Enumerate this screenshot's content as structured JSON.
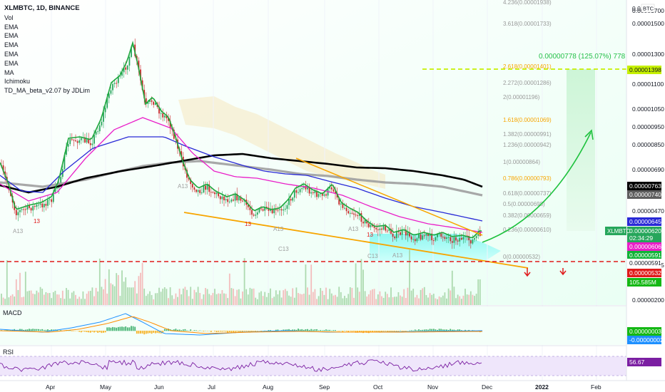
{
  "header": {
    "symbol": "XLMBTC, 1D, BINANCE",
    "indicators": [
      "Vol",
      "EMA",
      "EMA",
      "EMA",
      "EMA",
      "EMA",
      "MA",
      "Ichimoku",
      "TD_MA_beta_v2.07 by JDLim"
    ]
  },
  "panes": {
    "macd_label": "MACD",
    "rsi_label": "RSI"
  },
  "price_axis": {
    "currency": "BTC",
    "top_label": "0.0",
    "ticks": [
      "0.00001700",
      "0.00001500",
      "0.00001300",
      "0.00001100",
      "0.00001050",
      "0.00000950",
      "0.00000850",
      "0.00000690",
      "0.00000470",
      "0.00000435",
      "0.00000200"
    ]
  },
  "x_axis": {
    "labels": [
      "Apr",
      "May",
      "Jun",
      "Jul",
      "Aug",
      "Sep",
      "Oct",
      "Nov",
      "Dec",
      "2022",
      "Feb"
    ]
  },
  "badges": [
    {
      "text": "0.00001398",
      "bg": "#c6f000",
      "fg": "#131722"
    },
    {
      "text": "0.00000763",
      "bg": "#000000",
      "fg": "#ffffff"
    },
    {
      "text": "0.00000740",
      "bg": "#5d5d5d",
      "fg": "#ffffff"
    },
    {
      "text": "0.00000645",
      "bg": "#2929d6",
      "fg": "#ffffff"
    },
    {
      "text": "0.00000620",
      "bg": "#26a65b",
      "fg": "#ffffff"
    },
    {
      "text": "02:34:29",
      "bg": "#26a65b",
      "fg": "#ffffff"
    },
    {
      "text": "0.00000606",
      "bg": "#e91ec8",
      "fg": "#ffffff"
    },
    {
      "text": "0.00000591",
      "bg": "#0fb336",
      "fg": "#ffffff"
    },
    {
      "text": "0.00000591",
      "bg": "#ffffff",
      "fg": "#131722"
    },
    {
      "text": "0.00000532",
      "bg": "#e01a1a",
      "fg": "#ffffff"
    },
    {
      "text": "105.585M",
      "bg": "#14b814",
      "fg": "#ffffff"
    },
    {
      "text": "0.00000003",
      "bg": "#14b814",
      "fg": "#ffffff"
    },
    {
      "text": "-0.00000002",
      "bg": "#1e90ff",
      "fg": "#ffffff"
    },
    {
      "text": "56.67",
      "bg": "#7b1fa2",
      "fg": "#ffffff"
    }
  ],
  "symbol_tag": "XLMBTC",
  "target_label": "0.00000778 (125.07%) 778",
  "fib_levels": [
    {
      "text": "4.236(0.00001938)",
      "color": "#999999"
    },
    {
      "text": "3.618(0.00001733)",
      "color": "#999999"
    },
    {
      "text": "2.618(0.00001401)",
      "color": "#f7a500"
    },
    {
      "text": "2.272(0.00001286)",
      "color": "#999999"
    },
    {
      "text": "2(0.00001196)",
      "color": "#999999"
    },
    {
      "text": "1.618(0.00001069)",
      "color": "#f7a500"
    },
    {
      "text": "1.382(0.00000991)",
      "color": "#999999"
    },
    {
      "text": "1.236(0.00000942)",
      "color": "#999999"
    },
    {
      "text": "1(0.00000864)",
      "color": "#999999"
    },
    {
      "text": "0.786(0.00000793)",
      "color": "#f7a500"
    },
    {
      "text": "0.618(0.00000737)",
      "color": "#999999"
    },
    {
      "text": "0.5(0.00000698)",
      "color": "#999999"
    },
    {
      "text": "0.382(0.00000659)",
      "color": "#999999"
    },
    {
      "text": "0.236(0.00000610)",
      "color": "#999999"
    },
    {
      "text": "0(0.00000532)",
      "color": "#999999"
    }
  ],
  "td_labels": [
    "A13",
    "13",
    "A13",
    "13",
    "A13",
    "C13",
    "A13",
    "13",
    "C13",
    "A13"
  ],
  "colors": {
    "up": "#26a65b",
    "down": "#c62828",
    "ema_green": "#2bb24c",
    "ema_magenta": "#e91ec8",
    "ema_blue": "#2929d6",
    "ema_black": "#000000",
    "ma_gray": "#9e9e9e",
    "trend_orange": "#f7a500",
    "support_red": "#e01a1a",
    "target_green": "#26c04a"
  },
  "chart_data": {
    "type": "candlestick",
    "symbol": "XLMBTC",
    "interval": "1D",
    "exchange": "BINANCE",
    "x_labels": [
      "Apr",
      "May",
      "Jun",
      "Jul",
      "Aug",
      "Sep",
      "Oct",
      "Nov",
      "Dec",
      "2022",
      "Feb"
    ],
    "last_price": 6.2e-06,
    "approx_monthly_close": [
      {
        "month": "Apr",
        "price": 7.1e-06
      },
      {
        "month": "May",
        "price": 1.18e-05
      },
      {
        "month": "Jun",
        "price": 1.1e-05
      },
      {
        "month": "Jul",
        "price": 7.5e-06
      },
      {
        "month": "Aug",
        "price": 7.8e-06
      },
      {
        "month": "Sep",
        "price": 7.2e-06
      },
      {
        "month": "Oct",
        "price": 6.4e-06
      },
      {
        "month": "Nov",
        "price": 6.1e-06
      }
    ],
    "projection": {
      "target": 1.398e-05,
      "gain": "0.00000778 (125.07%) 778"
    },
    "support": 5.91e-06,
    "macd": {
      "macd": 3e-08,
      "signal": -2e-08
    },
    "rsi": 56.67,
    "volume": "105.585M"
  }
}
